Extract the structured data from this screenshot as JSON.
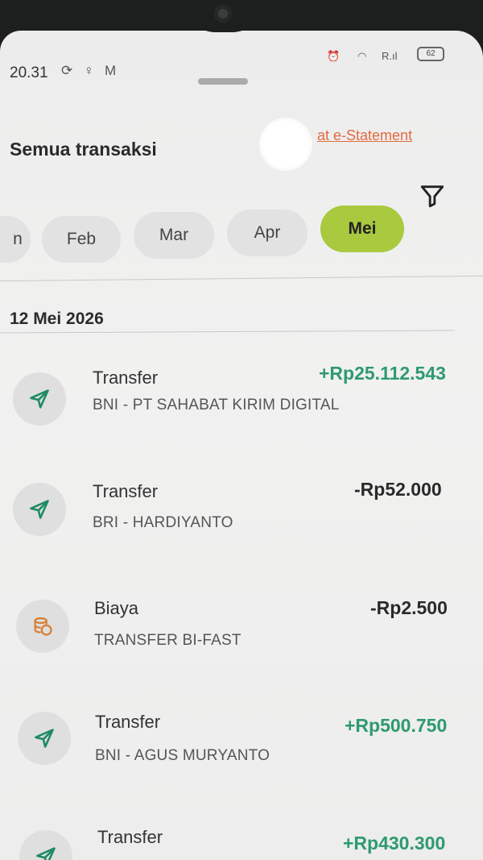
{
  "status_bar": {
    "time": "20.31",
    "battery": "62"
  },
  "header": {
    "title": "Semua transaksi",
    "estatement_link": "at e-Statement"
  },
  "months": [
    {
      "label": "n",
      "active": false
    },
    {
      "label": "Feb",
      "active": false
    },
    {
      "label": "Mar",
      "active": false
    },
    {
      "label": "Apr",
      "active": false
    },
    {
      "label": "Mei",
      "active": true
    }
  ],
  "date_group": {
    "date": "12 Mei 2026"
  },
  "transactions": [
    {
      "title": "Transfer",
      "subtitle": "BNI - PT SAHABAT KIRIM DIGITAL",
      "amount": "+Rp25.112.543",
      "direction": "in",
      "icon": "send-icon"
    },
    {
      "title": "Transfer",
      "subtitle": "BRI - HARDIYANTO",
      "amount": "-Rp52.000",
      "direction": "out",
      "icon": "send-icon"
    },
    {
      "title": "Biaya",
      "subtitle": "TRANSFER BI-FAST",
      "amount": "-Rp2.500",
      "direction": "out",
      "icon": "fee-coins-icon"
    },
    {
      "title": "Transfer",
      "subtitle": "BNI - AGUS MURYANTO",
      "amount": "+Rp500.750",
      "direction": "in",
      "icon": "send-icon"
    },
    {
      "title": "Transfer",
      "subtitle": "",
      "amount": "+Rp430.300",
      "direction": "in",
      "icon": "send-icon"
    }
  ],
  "colors": {
    "accent_chip": "#a9c93f",
    "positive_amount": "#2e9a6f",
    "link": "#e36b42"
  }
}
